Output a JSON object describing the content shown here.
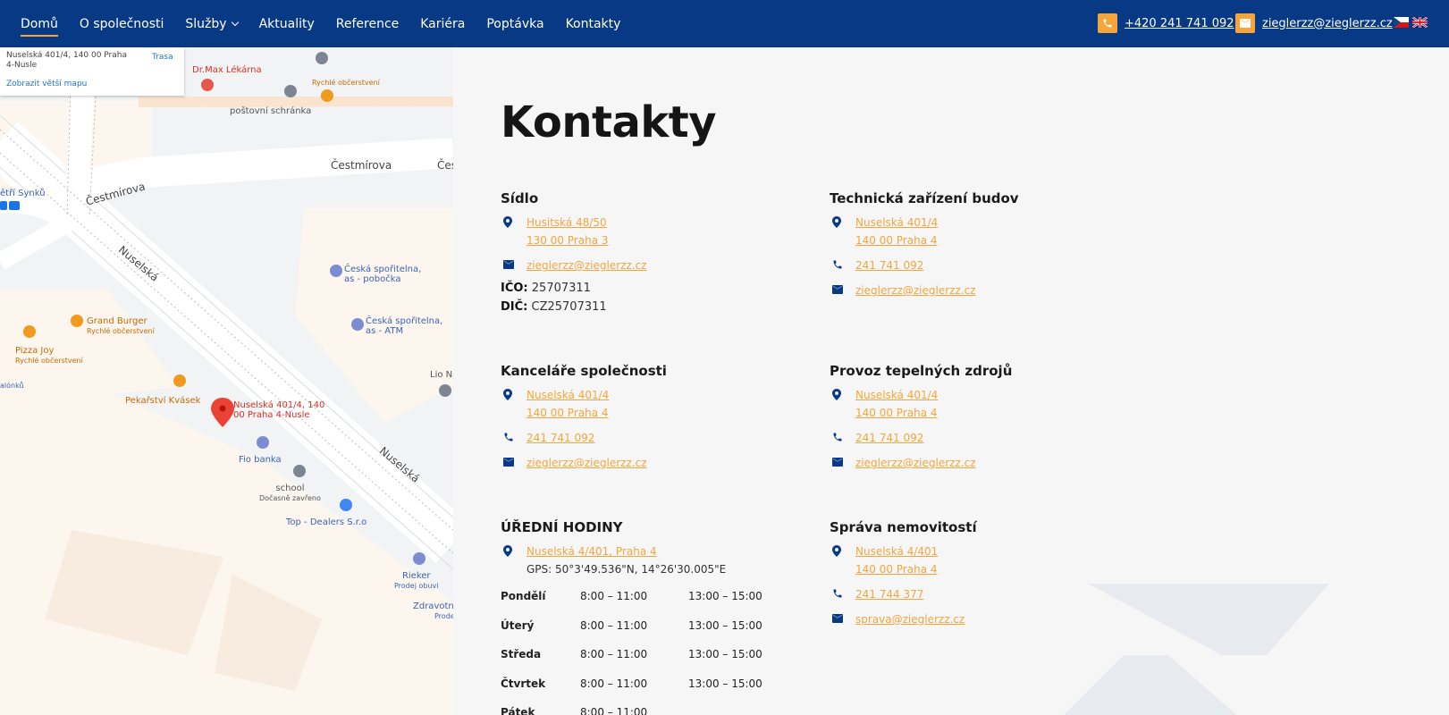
{
  "nav": {
    "items": [
      {
        "label": "Domů",
        "active": true
      },
      {
        "label": "O společnosti"
      },
      {
        "label": "Služby",
        "dropdown": true
      },
      {
        "label": "Aktuality"
      },
      {
        "label": "Reference"
      },
      {
        "label": "Kariéra"
      },
      {
        "label": "Poptávka"
      },
      {
        "label": "Kontakty"
      }
    ],
    "phone": "+420 241 741 092",
    "email": "zieglerzz@zieglerzz.cz",
    "accent": "#f5a53a",
    "background": "#083984"
  },
  "map": {
    "card_address": "Nuselská 401/4, 140 00 Praha 4-Nusle",
    "card_route": "Trasa",
    "card_bigger": "Zobrazit větší mapu",
    "labels": {
      "drmax": "Dr.Max Lékárna",
      "fastfood": "Rychlé občerstvení",
      "postbox": "poštovní schránka",
      "cestmirova1": "Čestmírova",
      "cestmirova2": "Čestmírova",
      "ces": "Čes",
      "synku": "ětří Synků",
      "nuselska1": "Nuselská",
      "nuselska2": "Nuselská",
      "cs_branch": "Česká spořitelna,",
      "cs_branch2": "as - pobočka",
      "cs_atm": "Česká spořitelna,",
      "cs_atm2": "as - ATM",
      "grand": "Grand Burger",
      "grand_sub": "Rychlé občerstvení",
      "pizza": "Pizza Joy",
      "pizza_sub": "Rychlé občerstvení",
      "lonku": "alónků",
      "lio": "Lio Na",
      "pekarstvi": "Pekařství Kvásek",
      "pin": "Nuselská 401/4, 140",
      "pin2": "00 Praha 4-Nusle",
      "fio": "Fio banka",
      "school": "school",
      "school_sub": "Dočasně zavřeno",
      "topdealers": "Top - Dealers S.r.o",
      "rieker": "Rieker",
      "rieker_sub": "Prodej obuvi",
      "zdrav": "Zdravotní",
      "zdrav_sub": "Prode"
    }
  },
  "title": "Kontakty",
  "sidlo": {
    "heading": "Sídlo",
    "addr1": "Husitská 48/50",
    "addr2": "130 00 Praha 3",
    "email": "zieglerzz@zieglerzz.cz",
    "ico_label": "IČO:",
    "ico": "25707311",
    "dic_label": "DIČ:",
    "dic": "CZ25707311"
  },
  "tzb": {
    "heading": "Technická zařízení budov",
    "addr1": "Nuselská 401/4",
    "addr2": "140 00 Praha 4",
    "phone": "241 741 092",
    "email": "zieglerzz@zieglerzz.cz"
  },
  "kancelare": {
    "heading": "Kanceláře společnosti",
    "addr1": "Nuselská 401/4",
    "addr2": "140 00 Praha 4",
    "phone": "241 741 092",
    "email": "zieglerzz@zieglerzz.cz"
  },
  "tepelne": {
    "heading": "Provoz tepelných zdrojů",
    "addr1": "Nuselská 401/4",
    "addr2": "140 00 Praha 4",
    "phone": "241 741 092",
    "email": "zieglerzz@zieglerzz.cz"
  },
  "hodiny": {
    "heading": "ÚŘEDNÍ HODINY",
    "addr": "Nuselská 4/401, Praha 4",
    "gps": "GPS: 50°3'49.536\"N, 14°26'30.005\"E",
    "rows": [
      {
        "day": "Pondělí",
        "am": "8:00 – 11:00",
        "pm": "13:00 – 15:00"
      },
      {
        "day": "Úterý",
        "am": "8:00 – 11:00",
        "pm": "13:00 – 15:00"
      },
      {
        "day": "Středa",
        "am": "8:00 – 11:00",
        "pm": "13:00 – 15:00"
      },
      {
        "day": "Čtvrtek",
        "am": "8:00 – 11:00",
        "pm": "13:00 – 15:00"
      },
      {
        "day": "Pátek",
        "am": "8:00 – 11:00",
        "pm": ""
      }
    ]
  },
  "sprava": {
    "heading": "Správa nemovitostí",
    "addr1": "Nuselská 4/401",
    "addr2": "140 00 Praha 4",
    "phone": "241 744 377",
    "email": "sprava@zieglerzz.cz"
  },
  "icons": {
    "pin": "map-pin-icon",
    "phone": "phone-icon",
    "mail": "envelope-icon",
    "icon_color": "#083984"
  }
}
